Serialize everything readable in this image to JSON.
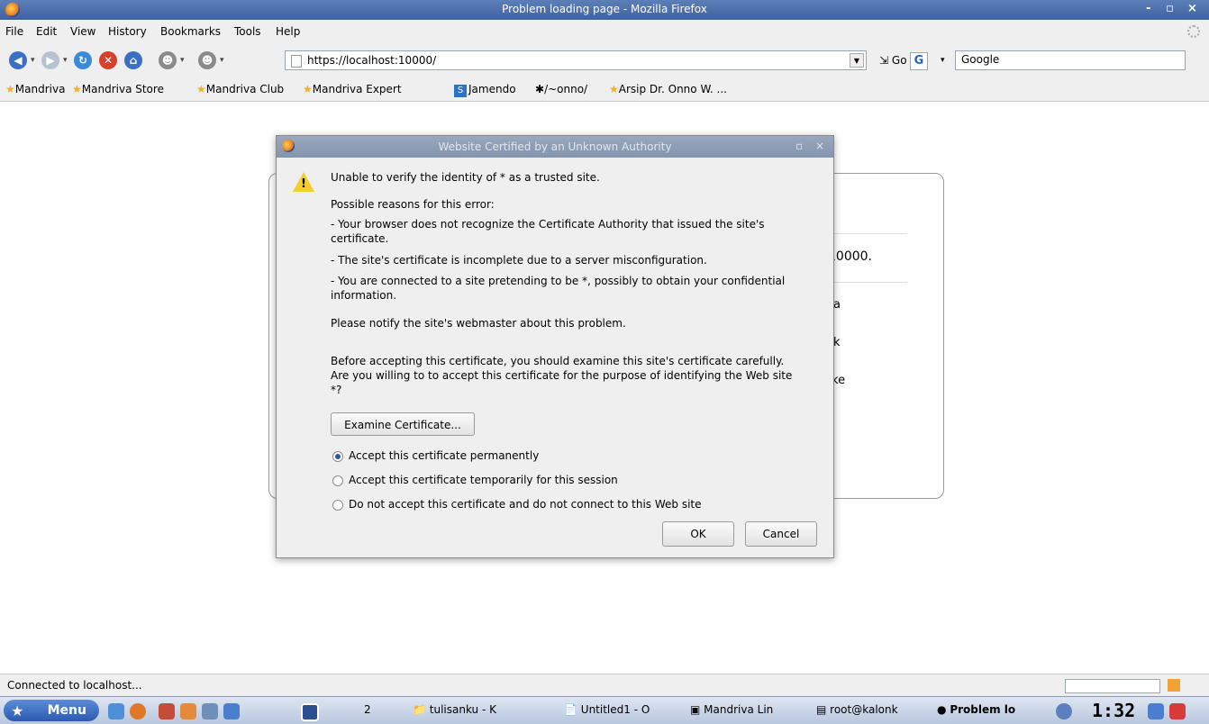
{
  "window": {
    "title": "Problem loading page - Mozilla Firefox",
    "controls": [
      "-",
      "▫",
      "×"
    ]
  },
  "menu": {
    "file": "File",
    "edit": "Edit",
    "view": "View",
    "history": "History",
    "bookmarks": "Bookmarks",
    "tools": "Tools",
    "help": "Help"
  },
  "nav": {
    "url": "https://localhost:10000/",
    "go_label": "Go",
    "search_value": "Google"
  },
  "bookmarks": [
    "Mandriva",
    "Mandriva Store",
    "Mandriva Club",
    "Mandriva Expert",
    "Jamendo",
    "/~onno/",
    "Arsip Dr. Onno W. ..."
  ],
  "error_page": {
    "fragment_port": "10000.",
    "fragment_a": "a",
    "fragment_k": "k",
    "fragment_ke": "ke"
  },
  "dialog": {
    "title": "Website Certified by an Unknown Authority",
    "intro": "Unable to verify the identity of * as a trusted site.",
    "reasons_heading": "Possible reasons for this error:",
    "reason1": "- Your browser does not recognize the Certificate Authority that issued the site's certificate.",
    "reason2": "- The site's certificate is incomplete due to a server misconfiguration.",
    "reason3": "- You are connected to a site pretending to be *, possibly to obtain your confidential information.",
    "notify": "Please notify the site's webmaster about this problem.",
    "before": "Before accepting this certificate, you should examine this site's certificate carefully. Are you willing to to accept this certificate for the purpose of identifying the Web site *?",
    "examine_button": "Examine Certificate...",
    "options": [
      {
        "label": "Accept this certificate permanently",
        "selected": true
      },
      {
        "label": "Accept this certificate temporarily for this session",
        "selected": false
      },
      {
        "label": "Do not accept this certificate and do not connect to this Web site",
        "selected": false
      }
    ],
    "ok_button": "OK",
    "cancel_button": "Cancel"
  },
  "status": {
    "text": "Connected to localhost..."
  },
  "taskbar": {
    "menu_label": "Menu",
    "desktop_number": "2",
    "tasks": [
      {
        "label": "tulisanku - K",
        "active": false
      },
      {
        "label": "Untitled1 - O",
        "active": false
      },
      {
        "label": "Mandriva Lin",
        "active": false
      },
      {
        "label": "root@kalonk",
        "active": false
      },
      {
        "label": "Problem lo",
        "active": true
      }
    ],
    "clock": "1:32"
  },
  "colors": {
    "titlebar": "#4a6ca8",
    "chrome": "#efefef",
    "dialog_title": "#8d9db4",
    "accent": "#2c55a8"
  }
}
